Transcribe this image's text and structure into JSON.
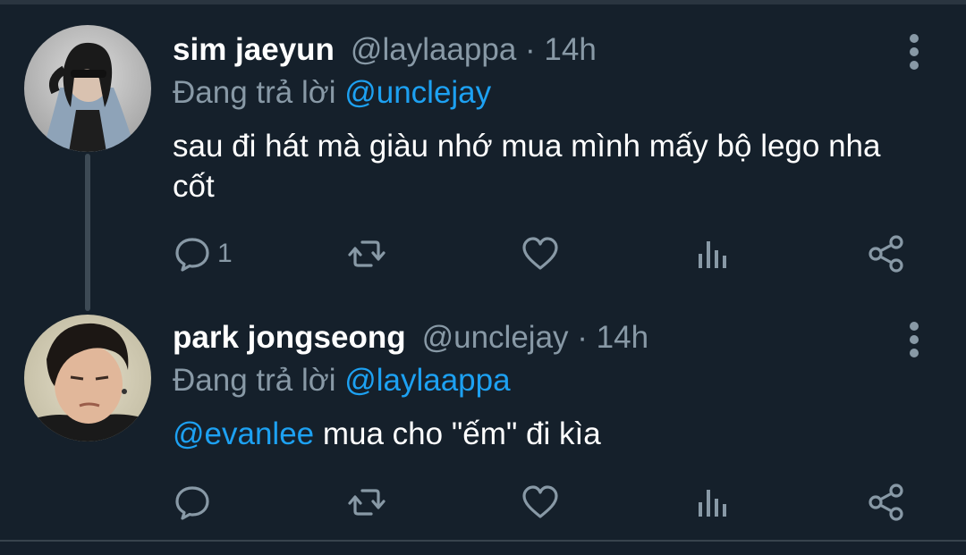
{
  "tweets": [
    {
      "name": "sim jaeyun",
      "handle": "@laylaappa · 14h",
      "reply_prefix": "Đang trả lời ",
      "reply_to": "@unclejay",
      "text": "sau đi hát mà giàu nhớ mua mình mấy bộ lego nha cốt",
      "reply_count": "1",
      "avatar": "avatar-photo"
    },
    {
      "name": "park jongseong",
      "handle": "@unclejay · 14h",
      "reply_prefix": "Đang trả lời ",
      "reply_to": "@laylaappa",
      "mention": "@evanlee",
      "text": " mua cho \"ếm\" đi kìa",
      "reply_count": "",
      "avatar": "avatar-photo"
    }
  ],
  "icons": {
    "reply": "comment-icon",
    "retweet": "retweet-icon",
    "like": "heart-icon",
    "analytics": "analytics-icon",
    "share": "share-icon",
    "more": "more-vertical-icon"
  },
  "colors": {
    "background": "#15202b",
    "text": "#ffffff",
    "secondary": "#8899a6",
    "accent": "#1da1f2"
  }
}
